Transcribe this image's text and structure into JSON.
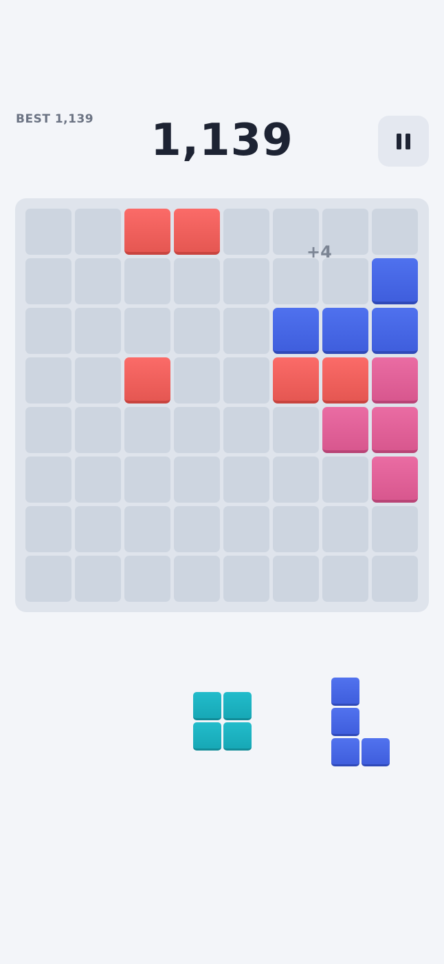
{
  "header": {
    "best_label": "BEST 1,139",
    "score": "1,139",
    "pause_icon": "pause-icon"
  },
  "board": {
    "rows": 8,
    "cols": 8,
    "colors": {
      "red": "#f4605c",
      "blue": "#4466e6",
      "pink": "#e0609a",
      "teal": "#1fb3c2",
      "empty": "#cdd5e0"
    },
    "grid": [
      [
        null,
        null,
        "red",
        "red",
        null,
        null,
        null,
        null
      ],
      [
        null,
        null,
        null,
        null,
        null,
        null,
        null,
        "blue"
      ],
      [
        null,
        null,
        null,
        null,
        null,
        "blue",
        "blue",
        "blue"
      ],
      [
        null,
        null,
        "red",
        null,
        null,
        "red",
        "red",
        "pink"
      ],
      [
        null,
        null,
        null,
        null,
        null,
        null,
        "pink",
        "pink"
      ],
      [
        null,
        null,
        null,
        null,
        null,
        null,
        null,
        "pink"
      ],
      [
        null,
        null,
        null,
        null,
        null,
        null,
        null,
        null
      ],
      [
        null,
        null,
        null,
        null,
        null,
        null,
        null,
        null
      ]
    ],
    "points_popup": "+4"
  },
  "tray": {
    "pieces": [
      {
        "name": "square-piece",
        "color": "teal",
        "cells": [
          [
            0,
            0
          ],
          [
            0,
            1
          ],
          [
            1,
            0
          ],
          [
            1,
            1
          ]
        ]
      },
      {
        "name": "l-piece",
        "color": "blue",
        "cells": [
          [
            0,
            0
          ],
          [
            1,
            0
          ],
          [
            2,
            0
          ],
          [
            2,
            1
          ]
        ]
      }
    ]
  }
}
